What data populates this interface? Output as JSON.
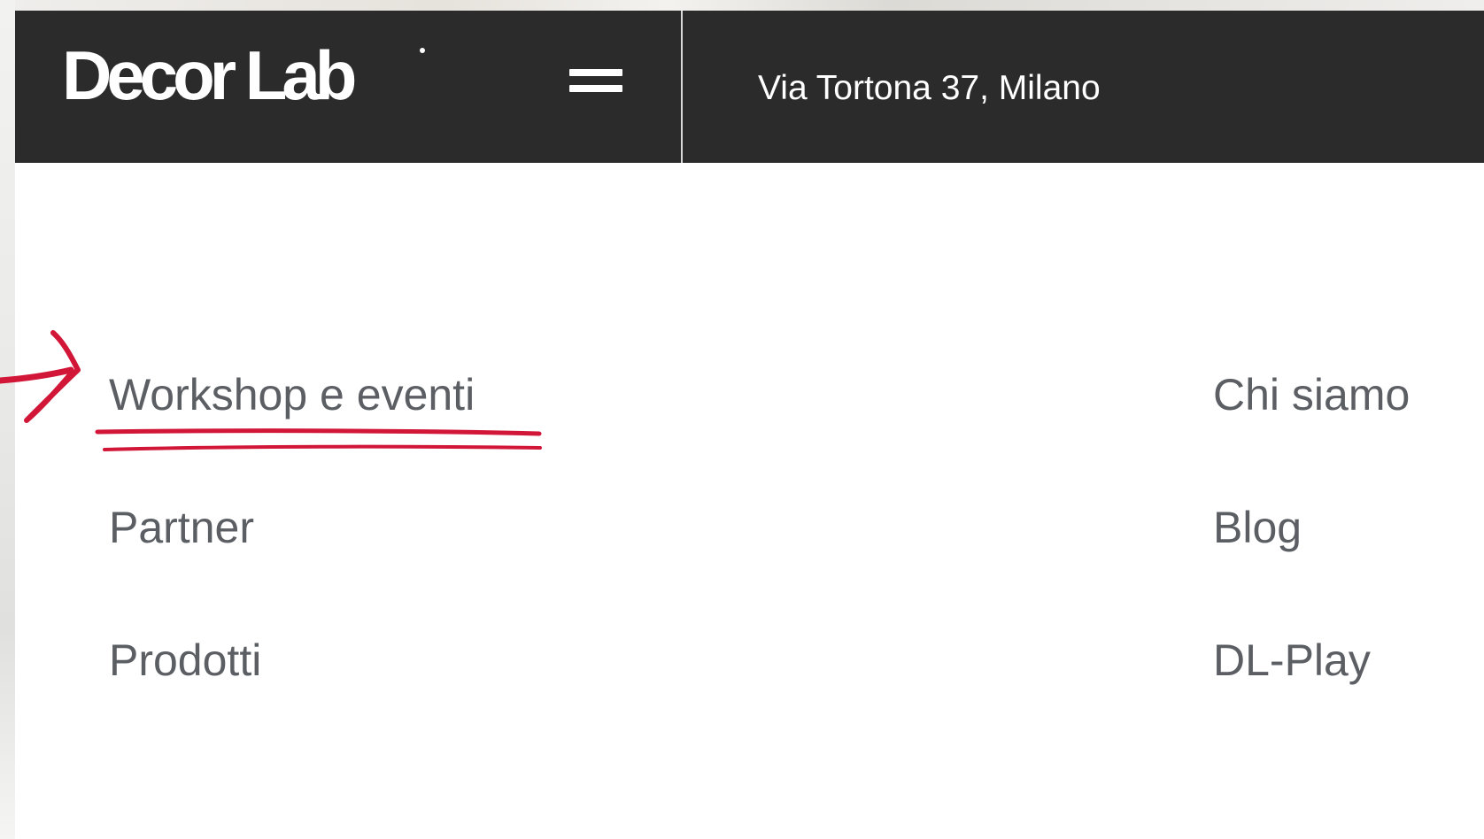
{
  "header": {
    "logo_text": "Decor Lab",
    "address": "Via Tortona 37, Milano",
    "background_color": "#2b2b2b"
  },
  "menu": {
    "left_items": [
      {
        "label": "Workshop e eventi"
      },
      {
        "label": "Partner"
      },
      {
        "label": "Prodotti"
      }
    ],
    "right_items": [
      {
        "label": "Chi siamo"
      },
      {
        "label": "Blog"
      },
      {
        "label": "DL-Play"
      }
    ],
    "text_color": "#5b5e63"
  },
  "annotation": {
    "color": "#d11638",
    "icons": [
      "arrow-icon",
      "underline-mark"
    ]
  }
}
